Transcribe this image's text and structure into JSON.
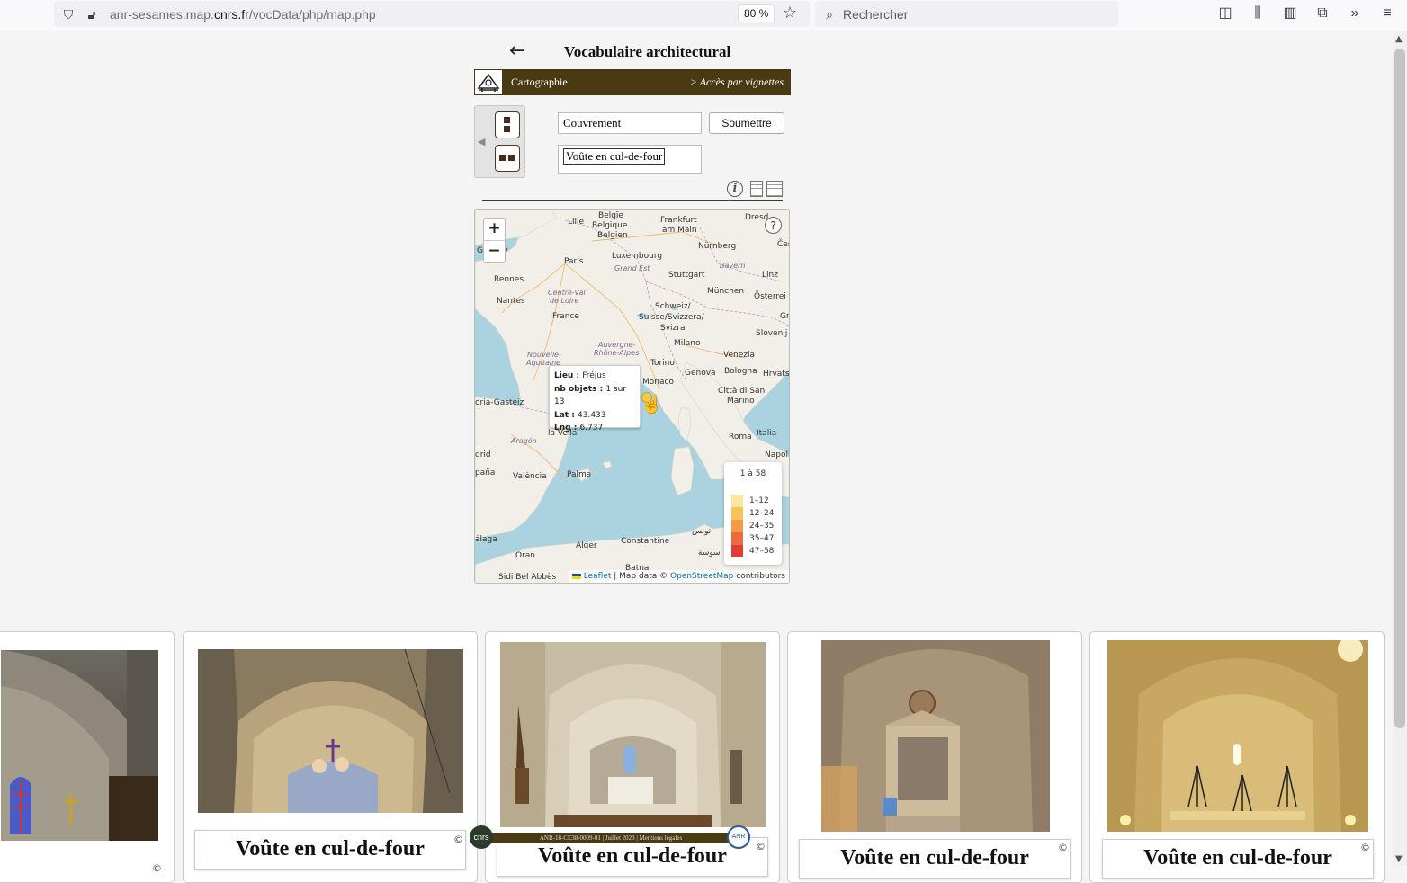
{
  "browser": {
    "url_prefix": "anr-sesames.map.",
    "url_domain": "cnrs.fr",
    "url_path": "/vocData/php/map.php",
    "zoom_level": "80 %",
    "search_placeholder": "Rechercher"
  },
  "header": {
    "back_glyph": "←",
    "title": "Vocabulaire architectural",
    "bar_left": "Cartographie",
    "bar_right": "> Accès par vignettes"
  },
  "form": {
    "field1_value": "Couvrement",
    "submit_label": "Soumettre",
    "field2_value": "Voûte en cul-de-four"
  },
  "map": {
    "zoom_in": "+",
    "zoom_out": "−",
    "help": "?",
    "cities": [
      {
        "name": "Belgïe",
        "cls": ""
      },
      {
        "name": "Belgique",
        "cls": ""
      },
      {
        "name": "Belgien",
        "cls": ""
      },
      {
        "name": "Lille",
        "cls": ""
      },
      {
        "name": "Frankfurt",
        "cls": ""
      },
      {
        "name": "am Main",
        "cls": ""
      },
      {
        "name": "Dresd",
        "cls": ""
      },
      {
        "name": "Gu  rsey",
        "cls": ""
      },
      {
        "name": "Luxembourg",
        "cls": ""
      },
      {
        "name": "Nürnberg",
        "cls": ""
      },
      {
        "name": "Čes",
        "cls": ""
      },
      {
        "name": "Paris",
        "cls": ""
      },
      {
        "name": "Grand Est",
        "cls": "region"
      },
      {
        "name": "Bayern",
        "cls": "region"
      },
      {
        "name": "Rennes",
        "cls": ""
      },
      {
        "name": "Stuttgart",
        "cls": ""
      },
      {
        "name": "Linz",
        "cls": ""
      },
      {
        "name": "Centre-Val",
        "cls": "region"
      },
      {
        "name": "de Loire",
        "cls": "region"
      },
      {
        "name": "München",
        "cls": ""
      },
      {
        "name": "Österrei",
        "cls": ""
      },
      {
        "name": "Nantes",
        "cls": ""
      },
      {
        "name": "Schweiz/",
        "cls": ""
      },
      {
        "name": "Suisse/Svizzera/",
        "cls": ""
      },
      {
        "name": "Svizra",
        "cls": ""
      },
      {
        "name": "France",
        "cls": ""
      },
      {
        "name": "Gra",
        "cls": ""
      },
      {
        "name": "Slovenij",
        "cls": ""
      },
      {
        "name": "Milano",
        "cls": ""
      },
      {
        "name": "Auvergne-",
        "cls": "region"
      },
      {
        "name": "Rhône-Alpes",
        "cls": "region"
      },
      {
        "name": "Nouvelle-",
        "cls": "region"
      },
      {
        "name": "Aquitaine",
        "cls": "region"
      },
      {
        "name": "Venezia",
        "cls": ""
      },
      {
        "name": "Torino",
        "cls": ""
      },
      {
        "name": "Bologna",
        "cls": ""
      },
      {
        "name": "Hrvats",
        "cls": ""
      },
      {
        "name": "Genova",
        "cls": ""
      },
      {
        "name": "Monaco",
        "cls": ""
      },
      {
        "name": "Città di San",
        "cls": ""
      },
      {
        "name": "Marino",
        "cls": ""
      },
      {
        "name": "oria-Gasteiz",
        "cls": ""
      },
      {
        "name": "Italia",
        "cls": ""
      },
      {
        "name": "la Vella",
        "cls": ""
      },
      {
        "name": "Roma",
        "cls": ""
      },
      {
        "name": "Aragón",
        "cls": "region"
      },
      {
        "name": "drid",
        "cls": ""
      },
      {
        "name": "Napoli",
        "cls": ""
      },
      {
        "name": "paña",
        "cls": ""
      },
      {
        "name": "València",
        "cls": ""
      },
      {
        "name": "Palma",
        "cls": ""
      },
      {
        "name": "تونس",
        "cls": ""
      },
      {
        "name": "álaga",
        "cls": ""
      },
      {
        "name": "Alger",
        "cls": ""
      },
      {
        "name": "Constantine",
        "cls": ""
      },
      {
        "name": "Oran",
        "cls": ""
      },
      {
        "name": "سوسة",
        "cls": ""
      },
      {
        "name": "Batna",
        "cls": ""
      },
      {
        "name": "Sidi Bel Abbès",
        "cls": ""
      }
    ],
    "tooltip": {
      "lieu_label": "Lieu",
      "lieu_value": "Fréjus",
      "nb_label": "nb objets",
      "nb_value": "1 sur 13",
      "lat_label": "Lat",
      "lat_value": "43.433",
      "lng_label": "Lng",
      "lng_value": "6.737"
    },
    "legend": {
      "title": "1 à 58",
      "items": [
        {
          "label": "1–12",
          "color": "#f8e8a0"
        },
        {
          "label": "12–24",
          "color": "#f7c35a"
        },
        {
          "label": "24–35",
          "color": "#f39b48"
        },
        {
          "label": "35–47",
          "color": "#ec6a40"
        },
        {
          "label": "47–58",
          "color": "#e23c38"
        }
      ]
    },
    "attribution": {
      "leaflet": "Leaflet",
      "sep": " | Map data © ",
      "osm": "OpenStreetMap",
      "tail": " contributors"
    }
  },
  "cards": [
    {
      "label": "",
      "copyright": "©"
    },
    {
      "label": "Voûte en cul-de-four",
      "copyright": "©"
    },
    {
      "label": "Voûte en cul-de-four",
      "copyright": "©"
    },
    {
      "label": "Voûte en cul-de-four",
      "copyright": "©"
    },
    {
      "label": "Voûte en cul-de-four",
      "copyright": "©"
    }
  ],
  "footer": {
    "text": "ANR-18-CE38-0009-01 | Juillet 2023 | Mentions légales",
    "cnrs": "cnrs",
    "anr": "ANR"
  },
  "colors": {
    "brand_brown": "#4a3a14",
    "sea": "#aad3df",
    "land": "#f2efe9"
  }
}
